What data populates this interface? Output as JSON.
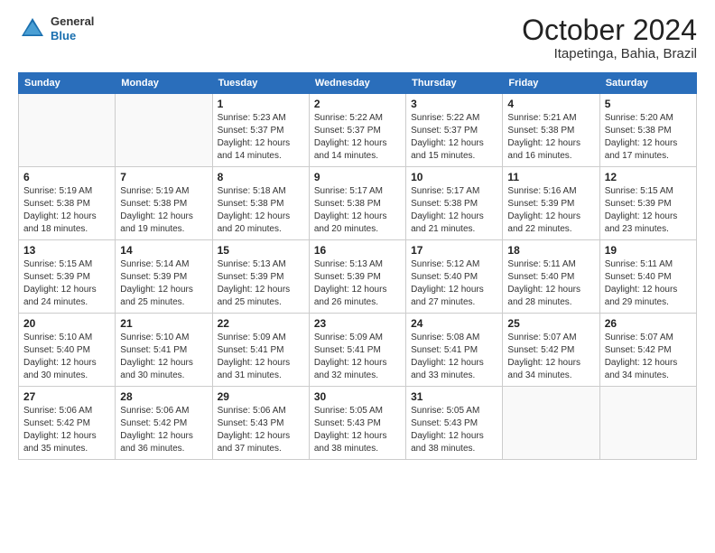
{
  "logo": {
    "general": "General",
    "blue": "Blue"
  },
  "title": "October 2024",
  "location": "Itapetinga, Bahia, Brazil",
  "weekdays": [
    "Sunday",
    "Monday",
    "Tuesday",
    "Wednesday",
    "Thursday",
    "Friday",
    "Saturday"
  ],
  "weeks": [
    [
      {
        "day": "",
        "info": ""
      },
      {
        "day": "",
        "info": ""
      },
      {
        "day": "1",
        "info": "Sunrise: 5:23 AM\nSunset: 5:37 PM\nDaylight: 12 hours and 14 minutes."
      },
      {
        "day": "2",
        "info": "Sunrise: 5:22 AM\nSunset: 5:37 PM\nDaylight: 12 hours and 14 minutes."
      },
      {
        "day": "3",
        "info": "Sunrise: 5:22 AM\nSunset: 5:37 PM\nDaylight: 12 hours and 15 minutes."
      },
      {
        "day": "4",
        "info": "Sunrise: 5:21 AM\nSunset: 5:38 PM\nDaylight: 12 hours and 16 minutes."
      },
      {
        "day": "5",
        "info": "Sunrise: 5:20 AM\nSunset: 5:38 PM\nDaylight: 12 hours and 17 minutes."
      }
    ],
    [
      {
        "day": "6",
        "info": "Sunrise: 5:19 AM\nSunset: 5:38 PM\nDaylight: 12 hours and 18 minutes."
      },
      {
        "day": "7",
        "info": "Sunrise: 5:19 AM\nSunset: 5:38 PM\nDaylight: 12 hours and 19 minutes."
      },
      {
        "day": "8",
        "info": "Sunrise: 5:18 AM\nSunset: 5:38 PM\nDaylight: 12 hours and 20 minutes."
      },
      {
        "day": "9",
        "info": "Sunrise: 5:17 AM\nSunset: 5:38 PM\nDaylight: 12 hours and 20 minutes."
      },
      {
        "day": "10",
        "info": "Sunrise: 5:17 AM\nSunset: 5:38 PM\nDaylight: 12 hours and 21 minutes."
      },
      {
        "day": "11",
        "info": "Sunrise: 5:16 AM\nSunset: 5:39 PM\nDaylight: 12 hours and 22 minutes."
      },
      {
        "day": "12",
        "info": "Sunrise: 5:15 AM\nSunset: 5:39 PM\nDaylight: 12 hours and 23 minutes."
      }
    ],
    [
      {
        "day": "13",
        "info": "Sunrise: 5:15 AM\nSunset: 5:39 PM\nDaylight: 12 hours and 24 minutes."
      },
      {
        "day": "14",
        "info": "Sunrise: 5:14 AM\nSunset: 5:39 PM\nDaylight: 12 hours and 25 minutes."
      },
      {
        "day": "15",
        "info": "Sunrise: 5:13 AM\nSunset: 5:39 PM\nDaylight: 12 hours and 25 minutes."
      },
      {
        "day": "16",
        "info": "Sunrise: 5:13 AM\nSunset: 5:39 PM\nDaylight: 12 hours and 26 minutes."
      },
      {
        "day": "17",
        "info": "Sunrise: 5:12 AM\nSunset: 5:40 PM\nDaylight: 12 hours and 27 minutes."
      },
      {
        "day": "18",
        "info": "Sunrise: 5:11 AM\nSunset: 5:40 PM\nDaylight: 12 hours and 28 minutes."
      },
      {
        "day": "19",
        "info": "Sunrise: 5:11 AM\nSunset: 5:40 PM\nDaylight: 12 hours and 29 minutes."
      }
    ],
    [
      {
        "day": "20",
        "info": "Sunrise: 5:10 AM\nSunset: 5:40 PM\nDaylight: 12 hours and 30 minutes."
      },
      {
        "day": "21",
        "info": "Sunrise: 5:10 AM\nSunset: 5:41 PM\nDaylight: 12 hours and 30 minutes."
      },
      {
        "day": "22",
        "info": "Sunrise: 5:09 AM\nSunset: 5:41 PM\nDaylight: 12 hours and 31 minutes."
      },
      {
        "day": "23",
        "info": "Sunrise: 5:09 AM\nSunset: 5:41 PM\nDaylight: 12 hours and 32 minutes."
      },
      {
        "day": "24",
        "info": "Sunrise: 5:08 AM\nSunset: 5:41 PM\nDaylight: 12 hours and 33 minutes."
      },
      {
        "day": "25",
        "info": "Sunrise: 5:07 AM\nSunset: 5:42 PM\nDaylight: 12 hours and 34 minutes."
      },
      {
        "day": "26",
        "info": "Sunrise: 5:07 AM\nSunset: 5:42 PM\nDaylight: 12 hours and 34 minutes."
      }
    ],
    [
      {
        "day": "27",
        "info": "Sunrise: 5:06 AM\nSunset: 5:42 PM\nDaylight: 12 hours and 35 minutes."
      },
      {
        "day": "28",
        "info": "Sunrise: 5:06 AM\nSunset: 5:42 PM\nDaylight: 12 hours and 36 minutes."
      },
      {
        "day": "29",
        "info": "Sunrise: 5:06 AM\nSunset: 5:43 PM\nDaylight: 12 hours and 37 minutes."
      },
      {
        "day": "30",
        "info": "Sunrise: 5:05 AM\nSunset: 5:43 PM\nDaylight: 12 hours and 38 minutes."
      },
      {
        "day": "31",
        "info": "Sunrise: 5:05 AM\nSunset: 5:43 PM\nDaylight: 12 hours and 38 minutes."
      },
      {
        "day": "",
        "info": ""
      },
      {
        "day": "",
        "info": ""
      }
    ]
  ]
}
